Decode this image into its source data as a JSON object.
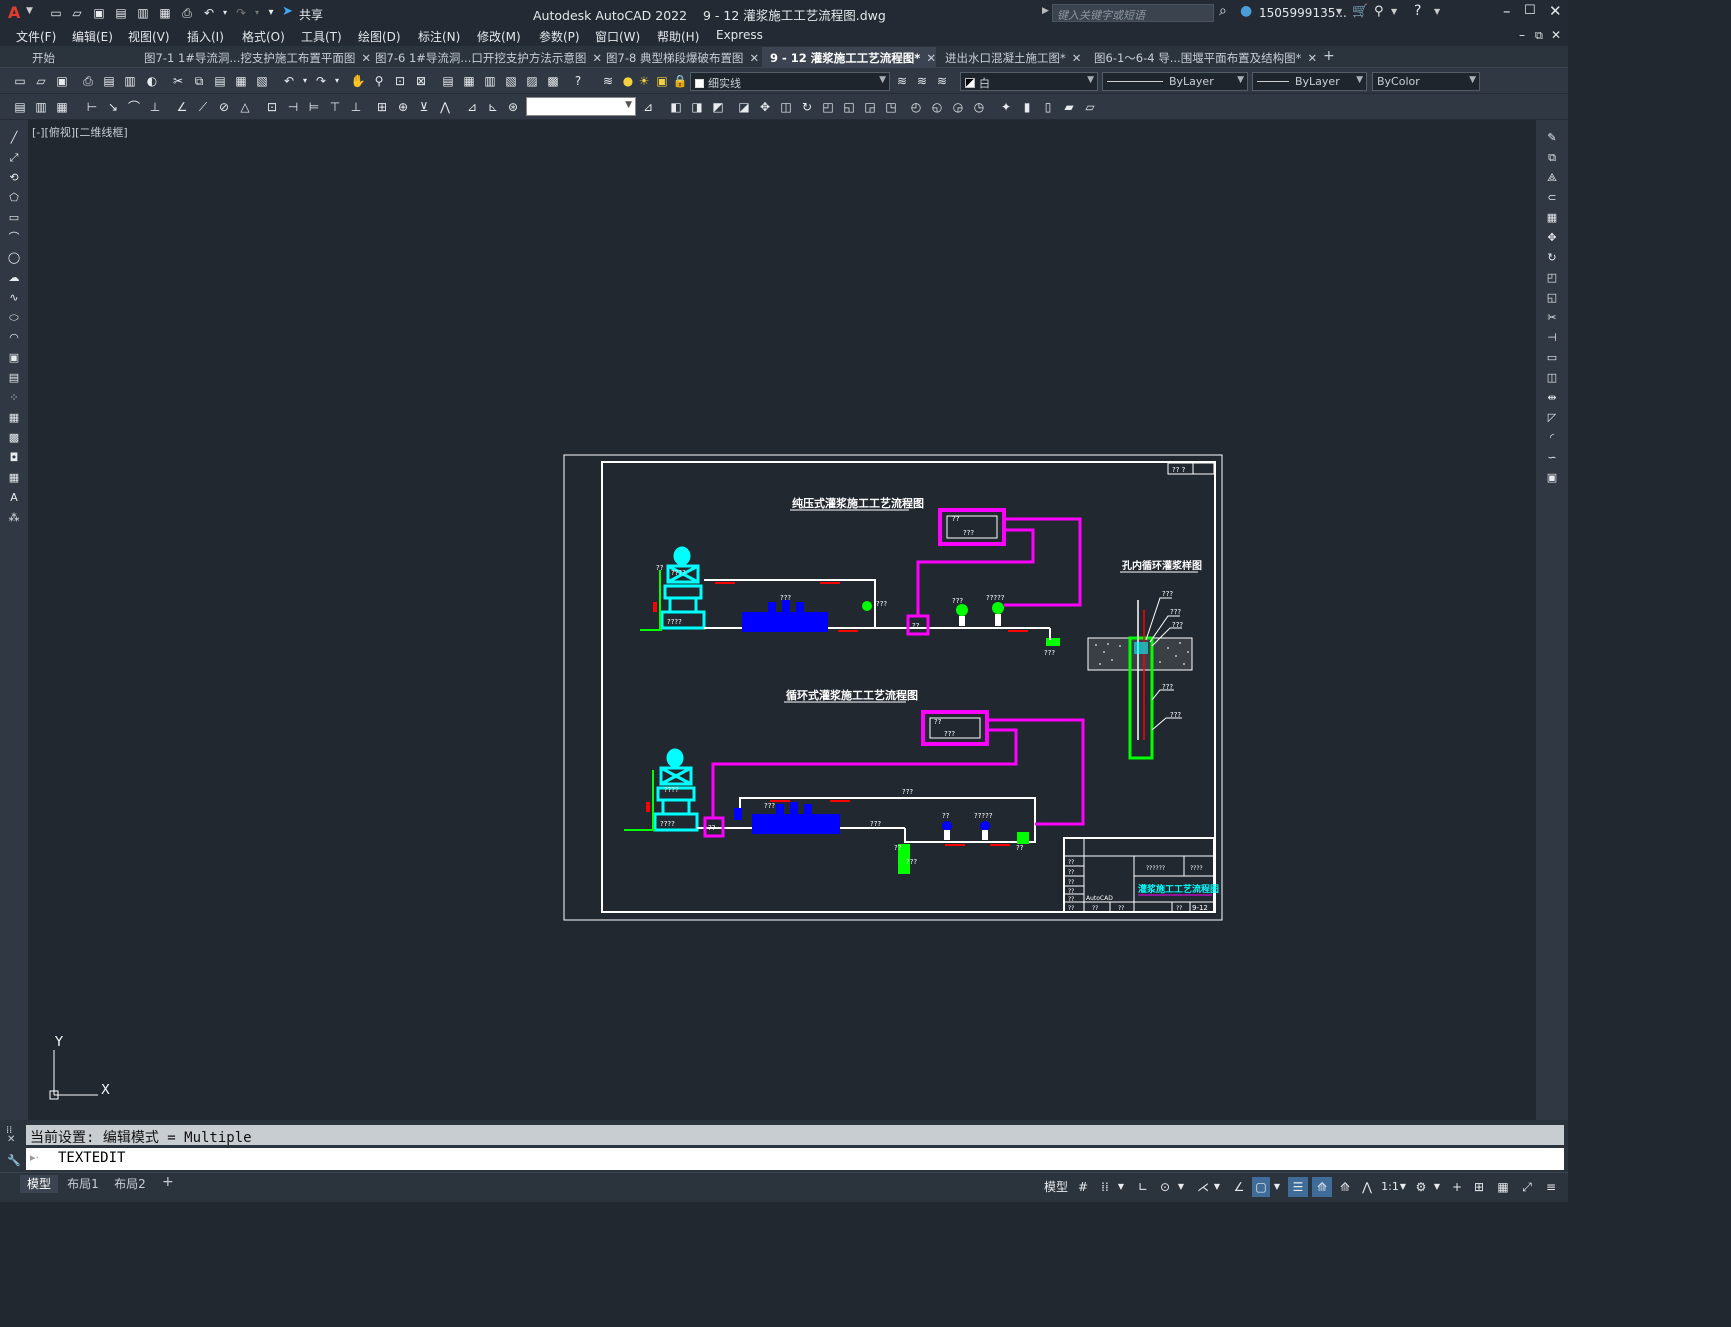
{
  "app": {
    "logo": "A",
    "window_title": "Autodesk AutoCAD 2022    9 - 12 灌浆施工工艺流程图.dwg",
    "search_placeholder": "键入关键字或短语",
    "user": "1505999135...",
    "share_label": "共享"
  },
  "menu": [
    "文件(F)",
    "编辑(E)",
    "视图(V)",
    "插入(I)",
    "格式(O)",
    "工具(T)",
    "绘图(D)",
    "标注(N)",
    "修改(M)",
    "参数(P)",
    "窗口(W)",
    "帮助(H)",
    "Express"
  ],
  "tabs": [
    {
      "label": "开始",
      "active": false,
      "closable": false
    },
    {
      "label": "图7-1 1#导流洞...挖支护施工布置平面图",
      "active": false,
      "closable": true
    },
    {
      "label": "图7-6 1#导流洞...口开挖支护方法示意图",
      "active": false,
      "closable": true
    },
    {
      "label": "图7-8 典型梯段爆破布置图",
      "active": false,
      "closable": true
    },
    {
      "label": "9 - 12 灌浆施工工艺流程图*",
      "active": true,
      "closable": true
    },
    {
      "label": "进出水口混凝土施工图*",
      "active": false,
      "closable": true
    },
    {
      "label": "图6-1～6-4 导...围堰平面布置及结构图*",
      "active": false,
      "closable": true
    }
  ],
  "toolbar": {
    "layer": "细实线",
    "color": "白",
    "linetype": "ByLayer",
    "lineweight": "ByLayer",
    "plotstyle": "ByColor"
  },
  "viewport_label": "[-][俯视][二维线框]",
  "drawing": {
    "title_top": "纯压式灌浆施工工艺流程图",
    "title_bottom": "循环式灌浆施工工艺流程图",
    "title_side": "孔内循环灌浆样图",
    "q2": "??",
    "q3": "???",
    "q4": "????",
    "q5": "?????",
    "q6": "??????",
    "sheet_title": "灌浆施工工艺流程图",
    "sheet_no": "9-12",
    "autocad": "AutoCAD",
    "top_right_label": "?? ?",
    "company": "????"
  },
  "ucs": {
    "x": "X",
    "y": "Y"
  },
  "command": {
    "history": "当前设置: 编辑模式 = Multiple",
    "prompt": "TEXTEDIT"
  },
  "layouts": [
    "模型",
    "布局1",
    "布局2"
  ],
  "status": {
    "model": "模型",
    "scale": "1:1"
  },
  "colors": {
    "cyan": "#00ffff",
    "magenta": "#ff00ff",
    "blue": "#0000ff",
    "green": "#00ff00",
    "red": "#ff0000",
    "white": "#ffffff",
    "bg": "#212830"
  }
}
